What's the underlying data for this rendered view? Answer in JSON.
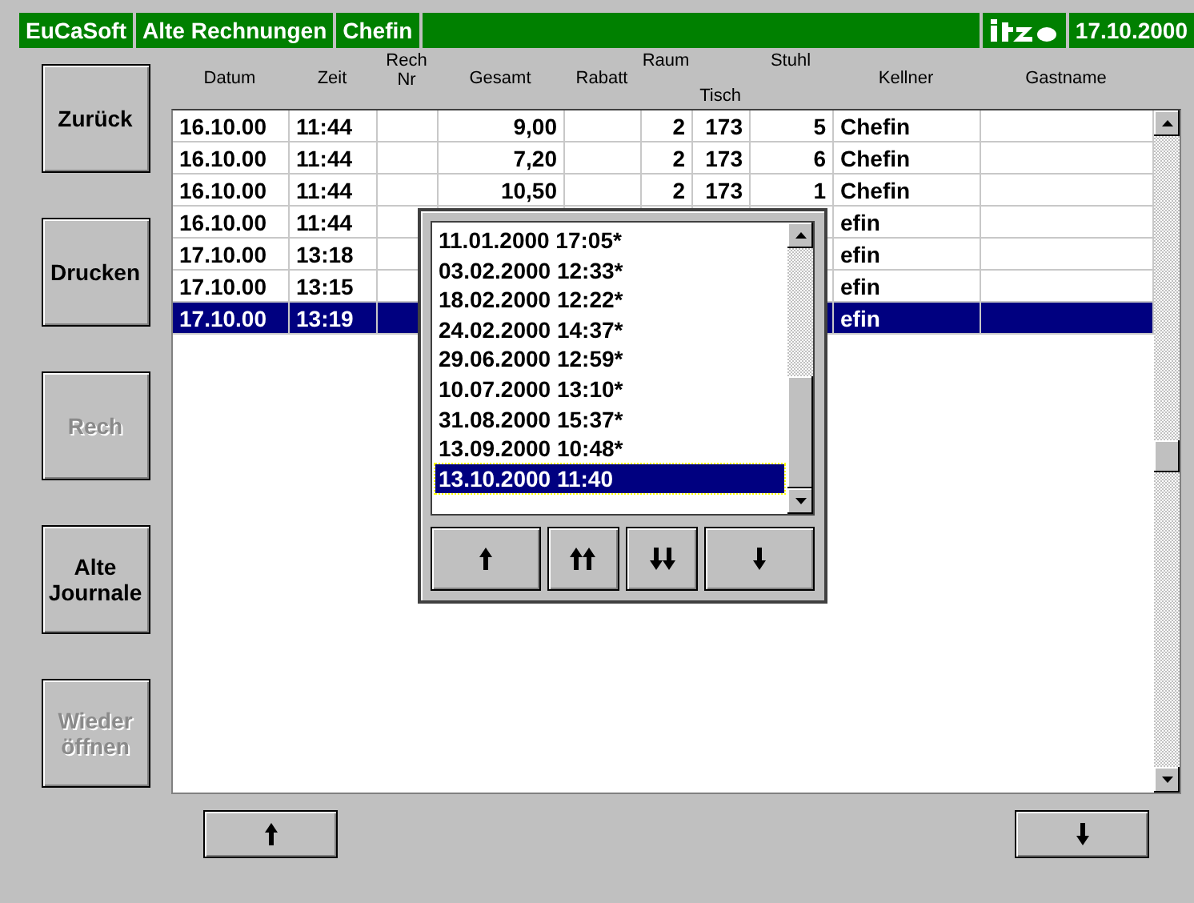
{
  "title_bar": {
    "cells": [
      "EuCaSoft",
      "Alte Rechnungen",
      "Chefin"
    ],
    "date": "17.10.2000"
  },
  "side_buttons": [
    {
      "label": "Zurück",
      "disabled": false
    },
    {
      "label": "Drucken",
      "disabled": false
    },
    {
      "label": "Rech",
      "disabled": true
    },
    {
      "label": "Alte Journale",
      "disabled": false
    },
    {
      "label": "Wieder öffnen",
      "disabled": true
    }
  ],
  "table": {
    "columns": [
      "Datum",
      "Zeit",
      "Rech Nr",
      "Gesamt",
      "Rabatt",
      "Raum",
      "Tisch",
      "Stuhl",
      "Kellner",
      "Gastname"
    ],
    "rows": [
      {
        "cells": [
          "16.10.00",
          "11:44",
          "",
          "9,00",
          "",
          "2",
          "173",
          "5",
          "Chefin",
          ""
        ],
        "selected": false
      },
      {
        "cells": [
          "16.10.00",
          "11:44",
          "",
          "7,20",
          "",
          "2",
          "173",
          "6",
          "Chefin",
          ""
        ],
        "selected": false
      },
      {
        "cells": [
          "16.10.00",
          "11:44",
          "",
          "10,50",
          "",
          "2",
          "173",
          "1",
          "Chefin",
          ""
        ],
        "selected": false
      },
      {
        "cells": [
          "16.10.00",
          "11:44",
          "",
          "",
          "",
          "",
          "",
          "",
          "efin",
          ""
        ],
        "selected": false
      },
      {
        "cells": [
          "17.10.00",
          "13:18",
          "",
          "",
          "",
          "",
          "",
          "",
          "efin",
          ""
        ],
        "selected": false
      },
      {
        "cells": [
          "17.10.00",
          "13:15",
          "",
          "",
          "",
          "",
          "",
          "",
          "efin",
          ""
        ],
        "selected": false
      },
      {
        "cells": [
          "17.10.00",
          "13:19",
          "",
          "",
          "",
          "",
          "",
          "",
          "efin",
          ""
        ],
        "selected": true
      }
    ]
  },
  "journal_popup": {
    "items": [
      {
        "label": "11.01.2000 17:05*",
        "selected": false
      },
      {
        "label": "03.02.2000 12:33*",
        "selected": false
      },
      {
        "label": "18.02.2000 12:22*",
        "selected": false
      },
      {
        "label": "24.02.2000 14:37*",
        "selected": false
      },
      {
        "label": "29.06.2000 12:59*",
        "selected": false
      },
      {
        "label": "10.07.2000 13:10*",
        "selected": false
      },
      {
        "label": "31.08.2000 15:37*",
        "selected": false
      },
      {
        "label": "13.09.2000 10:48*",
        "selected": false
      },
      {
        "label": "13.10.2000 11:40",
        "selected": true
      }
    ]
  }
}
